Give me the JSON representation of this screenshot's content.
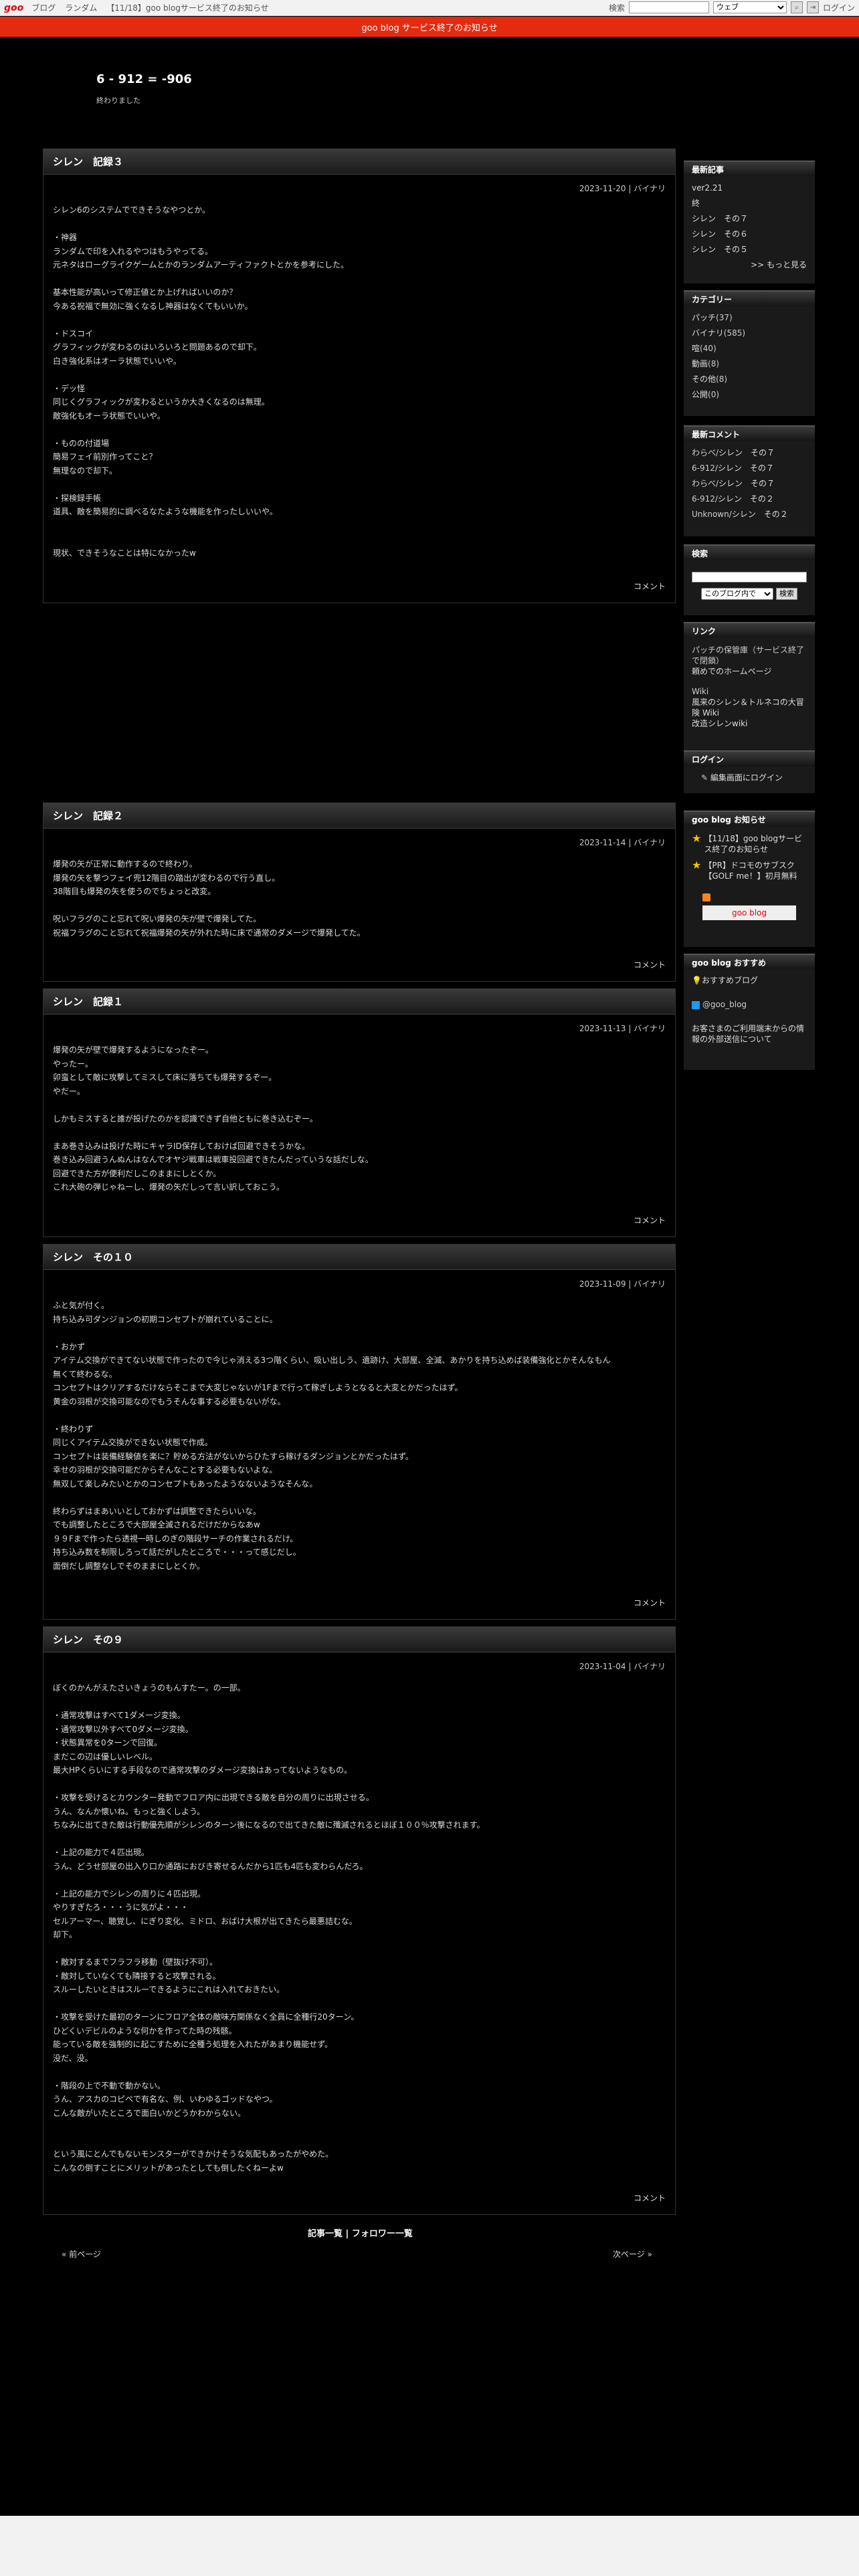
{
  "topbar": {
    "logo": "goo",
    "links": [
      "ブログ",
      "ランダム",
      "【11/18】goo blogサービス終了のお知らせ"
    ],
    "search_label": "検索",
    "search_value": "",
    "select_value": "ウェブ",
    "login": "ログイン"
  },
  "notice": "goo blog サービス終了のお知らせ",
  "blog": {
    "title": "6 - 912 = -906",
    "description": "終わりました"
  },
  "entries": [
    {
      "title": "シレン　記録３",
      "meta": "2023-11-20 | バイナリ",
      "lines": [
        "シレン6のシステムでできそうなやつとか。",
        "",
        "・神器",
        "ランダムで印を入れるやつはもうやってる。",
        "元ネタはローグライクゲームとかのランダムアーティファクトとかを参考にした。",
        "",
        "基本性能が高いって修正値とか上げればいいのか？",
        "今ある祝福で無効に強くなるし神器はなくてもいいか。",
        "",
        "・ドスコイ",
        "グラフィックが変わるのはいろいろと問題あるので却下。",
        "白き強化系はオーラ状態でいいや。",
        "",
        "・デッ怪",
        "同じくグラフィックが変わるというか大きくなるのは無理。",
        "敵強化もオーラ状態でいいや。",
        "",
        "・ものの付道場",
        "簡易フェイ前別作ってこと？",
        "無理なので却下。",
        "",
        "・探検録手帳",
        "道具、敵を簡易的に調べるなたような機能を作ったしいいや。",
        "",
        "",
        "現状、できそうなことは特になかったw"
      ],
      "comment": "コメント"
    },
    {
      "title": "シレン　記録２",
      "meta": "2023-11-14 | バイナリ",
      "lines": [
        "爆発の矢が正常に動作するので終わり。",
        "爆発の矢を撃つフェイ兜12階目の踏出が変わるので行う直し。",
        "38階目も爆発の矢を使うのでちょっと改変。",
        "",
        "呪いフラグのこと忘れて呪い爆発の矢が壁で爆発してた。",
        "祝福フラグのこと忘れて祝福爆発の矢が外れた時に床で通常のダメージで爆発してた。"
      ],
      "comment": "コメント"
    },
    {
      "title": "シレン　記録１",
      "meta": "2023-11-13 | バイナリ",
      "lines": [
        "爆発の矢が壁で爆発するようになったぞー。",
        "やったー。",
        "卯蛮として敵に攻撃してミスして床に落ちても爆発するぞー。",
        "やだー。",
        "",
        "しかもミスすると誰が投げたのかを認識できず自他ともに巻き込むぞー。",
        "",
        "まあ巻き込みは投げた時にキャラID保存しておけば回避できそうかな。",
        "巻き込み回避うんぬんはなんでオヤジ戦車は戦車投回避できたんだっていうな話だしな。",
        "回避できた方が便利だしこのままにしとくか。",
        "これ大砲の弾じゃねーし、爆発の矢だしって言い訳しておこう。"
      ],
      "comment": "コメント"
    },
    {
      "title": "シレン　その１０",
      "meta": "2023-11-09 | バイナリ",
      "lines": [
        "ふと気が付く。",
        "持ち込み可ダンジョンの初期コンセプトが崩れていることに。",
        "",
        "・おかず",
        "アイテム交換ができてない状態で作ったので今じゃ消える3つ階くらい、吸い出しう、遺跡け、大部屋、全滅、あかりを持ち込めば装備強化とかそんなもん",
        "無くて終わるな。",
        "コンセプトはクリアするだけならそこまで大変じゃないが1Fまで行って稼ぎしようとなると大変とかだったはず。",
        "黄金の羽根が交換可能なのでもうそんな事する必要もないがな。",
        "",
        "・終わりず",
        "同じくアイテム交換ができない状態で作成。",
        "コンセプトは装備経験値を楽に？貯める方法がないからひたすら稼げるダンジョンとかだったはず。",
        "幸せの羽根が交換可能だからそんなことする必要もないよな。",
        "無双して楽しみたいとかのコンセプトもあったようなないようなそんな。",
        "",
        "終わらずはまあいいとしておかずは調整できたらいいな。",
        "でも調整したところで大部屋全滅されるだけだからなあw",
        "９９Fまで作ったら透視一時しのぎの階段サーチの作業されるだけ。",
        "持ち込み数を制限しろって話だがしたところで・・・って感じだし。",
        "面倒だし調整なしでそのままにしとくか。"
      ],
      "comment": "コメント"
    },
    {
      "title": "シレン　その９",
      "meta": "2023-11-04 | バイナリ",
      "lines": [
        "ぼくのかんがえたさいきょうのもんすたー。の一部。",
        "",
        "・通常攻撃はすべて1ダメージ変換。",
        "・通常攻撃以外すべて0ダメージ変換。",
        "・状態異常を0ターンで回復。",
        "まだこの辺は優しいレベル。",
        "最大HPくらいにする手段なので通常攻撃のダメージ変換はあってないようなもの。",
        "",
        "・攻撃を受けるとカウンター発動でフロア内に出現できる敵を自分の周りに出現させる。",
        "うん、なんか懐いね。もっと強くしよう。",
        "ちなみに出てきた敵は行動優先順がシレンのターン後になるので出てきた敵に殲滅されるとほぼ１００％攻撃されます。",
        "",
        "・上記の能力で４匹出現。",
        "うん、どうせ部屋の出入り口か通路におびき寄せるんだから1匹も4匹も変わらんだろ。",
        "",
        "・上記の能力でシレンの周りに４匹出現。",
        "やりすぎたろ・・・うに気がよ・・・",
        "セルアーマー、聴覚し、にぎり変化、ミドロ、おばけ大根が出てきたら最悪詰むな。",
        "却下。",
        "",
        "・敵対するまでフラフラ移動（壁抜け不可）。",
        "・敵対していなくても隣接すると攻撃される。",
        "スルーしたいときはスルーできるようにこれは入れておきたい。",
        "",
        "・攻撃を受けた最初のターンにフロア全体の敵味方関係なく全員に全種行20ターン。",
        "ひどくいデビルのような何かを作ってた時の残骸。",
        "能っている敵を強制的に起こすために全種う処理を入れたがあまり機能せず。",
        "没だ、没。",
        "",
        "・階段の上で不動で動かない。",
        "うん、アスカのコピペで有名な、例、いわゆるゴッドなやつ。",
        "こんな敵がいたところで面白いかどうかわからない。",
        "",
        "",
        "という風にとんでもないモンスターができかけそうな気配もあったがやめた。",
        "こんなの倒すことにメリットがあったとしても倒したくねーよw"
      ],
      "comment": "コメント"
    }
  ],
  "sidebar": {
    "recent": {
      "heading": "最新記事",
      "items": [
        "ver2.21",
        "終",
        "シレン　その７",
        "シレン　その６",
        "シレン　その５"
      ],
      "more": ">> もっと見る"
    },
    "category": {
      "heading": "カテゴリー",
      "items": [
        {
          "name": "パッチ",
          "count": "(37)"
        },
        {
          "name": "バイナリ",
          "count": "(585)"
        },
        {
          "name": "喧",
          "count": "(40)"
        },
        {
          "name": "動画",
          "count": "(8)"
        },
        {
          "name": "その他",
          "count": "(8)"
        },
        {
          "name": "公開",
          "count": "(0)"
        }
      ]
    },
    "comments": {
      "heading": "最新コメント",
      "items": [
        {
          "user": "わらべ/",
          "title": "シレン　その７"
        },
        {
          "user": "6-912/",
          "title": "シレン　その７"
        },
        {
          "user": "わらべ/",
          "title": "シレン　その７"
        },
        {
          "user": "6-912/",
          "title": "シレン　その２"
        },
        {
          "user": "Unknown/",
          "title": "シレン　その２"
        }
      ]
    },
    "search": {
      "heading": "検索",
      "input_value": "",
      "scope": "このブログ内で",
      "button": "検索"
    },
    "links": {
      "heading": "リンク",
      "text1": "パッチの保管庫（サービス終了で閉鎖）",
      "link1": "頼めでのホームページ",
      "wiki_label": "Wiki",
      "link2": "風来のシレン＆トルネコの大冒険 Wiki",
      "link3": "改造シレンwiki"
    },
    "login": {
      "heading": "ログイン",
      "link": "編集画面にログイン"
    },
    "goo_notice": {
      "heading": "goo blog お知らせ",
      "items": [
        "【11/18】goo blogサービス終了のお知らせ",
        "【PR】ドコモのサブスク【GOLF me！】初月無料"
      ],
      "badge": "goo blog"
    },
    "recommend": {
      "heading": "goo blog おすすめ",
      "link": "おすすめブログ",
      "twitter": "@goo_blog",
      "info": "お客さまのご利用端末からの情報の外部送信について"
    }
  },
  "pager": {
    "list": "記事一覧",
    "sep": " | ",
    "follow": "フォロワー一覧",
    "prev": "« 前ページ",
    "next": "次ページ »"
  }
}
